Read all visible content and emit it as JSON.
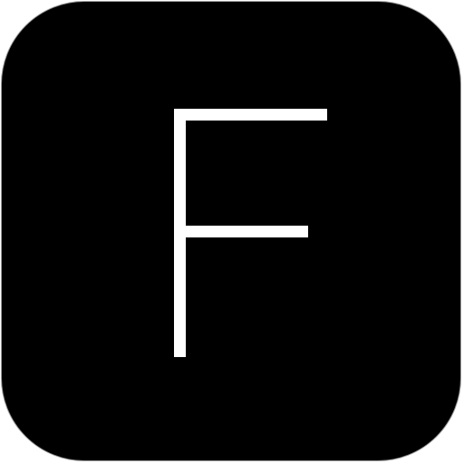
{
  "app_icon": {
    "letter": "F",
    "colors": {
      "background": "#000000",
      "border": "#9a9a9a",
      "glyph": "#ffffff"
    }
  }
}
